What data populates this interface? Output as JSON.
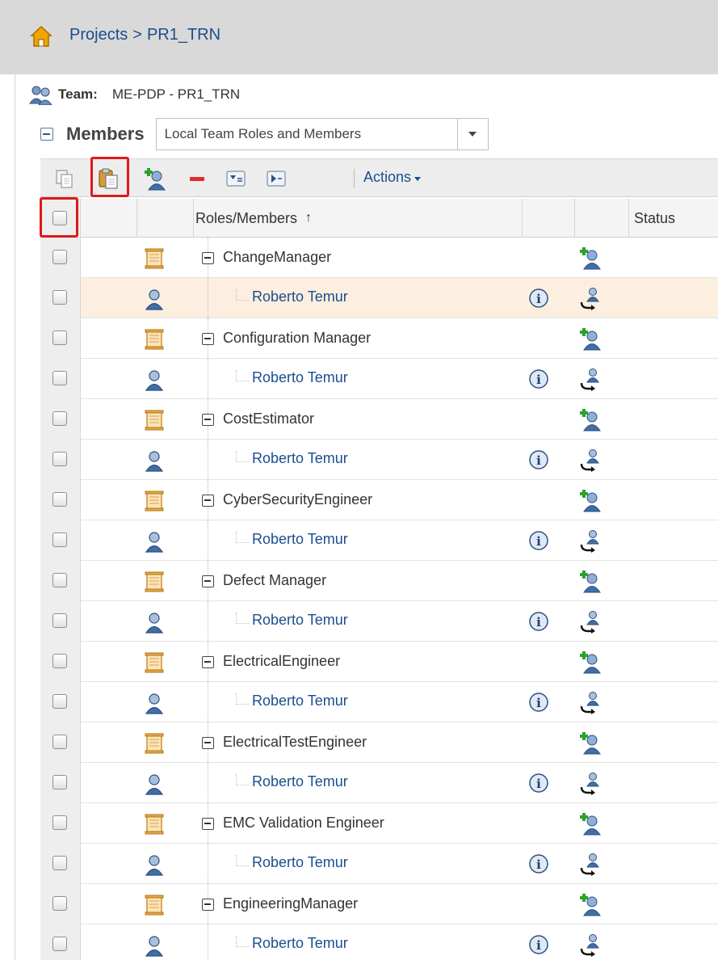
{
  "breadcrumb": {
    "home_icon": "home-icon",
    "projects": "Projects",
    "sep": ">",
    "current": "PR1_TRN"
  },
  "team": {
    "label": "Team:",
    "value": "ME-PDP - PR1_TRN"
  },
  "members": {
    "label": "Members",
    "view_select": "Local Team Roles and Members"
  },
  "toolbar": {
    "actions_label": "Actions",
    "buttons": [
      "copy-icon",
      "paste-icon",
      "add-member-icon",
      "remove-icon",
      "filter-icon",
      "expand-icon"
    ],
    "highlight_color": "#e01919"
  },
  "columns": {
    "roles_members": "Roles/Members",
    "sort_indicator": "↑",
    "status": "Status"
  },
  "rows": [
    {
      "type": "role",
      "name": "ChangeManager"
    },
    {
      "type": "member",
      "name": "Roberto Temur"
    },
    {
      "type": "role",
      "name": "Configuration Manager"
    },
    {
      "type": "member",
      "name": "Roberto Temur"
    },
    {
      "type": "role",
      "name": "CostEstimator"
    },
    {
      "type": "member",
      "name": "Roberto Temur"
    },
    {
      "type": "role",
      "name": "CyberSecurityEngineer"
    },
    {
      "type": "member",
      "name": "Roberto Temur"
    },
    {
      "type": "role",
      "name": "Defect Manager"
    },
    {
      "type": "member",
      "name": "Roberto Temur"
    },
    {
      "type": "role",
      "name": "ElectricalEngineer"
    },
    {
      "type": "member",
      "name": "Roberto Temur"
    },
    {
      "type": "role",
      "name": "ElectricalTestEngineer"
    },
    {
      "type": "member",
      "name": "Roberto Temur"
    },
    {
      "type": "role",
      "name": "EMC Validation Engineer"
    },
    {
      "type": "member",
      "name": "Roberto Temur"
    },
    {
      "type": "role",
      "name": "EngineeringManager"
    },
    {
      "type": "member",
      "name": "Roberto Temur"
    }
  ]
}
